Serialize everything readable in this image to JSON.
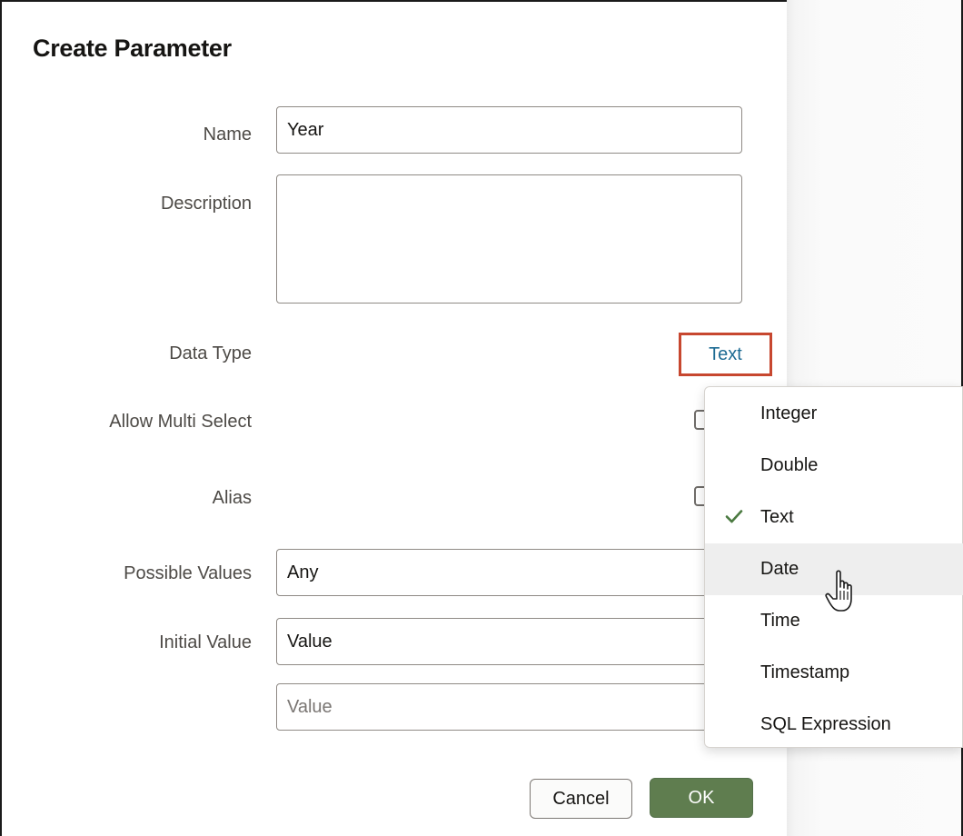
{
  "dialog": {
    "title": "Create Parameter"
  },
  "form": {
    "name": {
      "label": "Name",
      "value": "Year"
    },
    "description": {
      "label": "Description",
      "value": ""
    },
    "data_type": {
      "label": "Data Type",
      "value": "Text"
    },
    "allow_multi_select": {
      "label": "Allow Multi Select",
      "checked": false
    },
    "alias": {
      "label": "Alias",
      "checked": false
    },
    "possible_values": {
      "label": "Possible Values",
      "value": "Any"
    },
    "initial_value": {
      "label": "Initial Value",
      "value": "Value"
    },
    "initial_value_input": {
      "placeholder": "Value"
    }
  },
  "data_type_menu": {
    "items": [
      {
        "label": "Integer",
        "selected": false,
        "hovered": false
      },
      {
        "label": "Double",
        "selected": false,
        "hovered": false
      },
      {
        "label": "Text",
        "selected": true,
        "hovered": false
      },
      {
        "label": "Date",
        "selected": false,
        "hovered": true
      },
      {
        "label": "Time",
        "selected": false,
        "hovered": false
      },
      {
        "label": "Timestamp",
        "selected": false,
        "hovered": false
      },
      {
        "label": "SQL Expression",
        "selected": false,
        "hovered": false
      }
    ],
    "check_icon": "checkmark-icon"
  },
  "buttons": {
    "cancel": "Cancel",
    "ok": "OK"
  },
  "colors": {
    "highlight_border": "#c7472f",
    "link": "#1d6b93",
    "ok_button": "#5f7d4f",
    "check": "#4b7a41"
  }
}
